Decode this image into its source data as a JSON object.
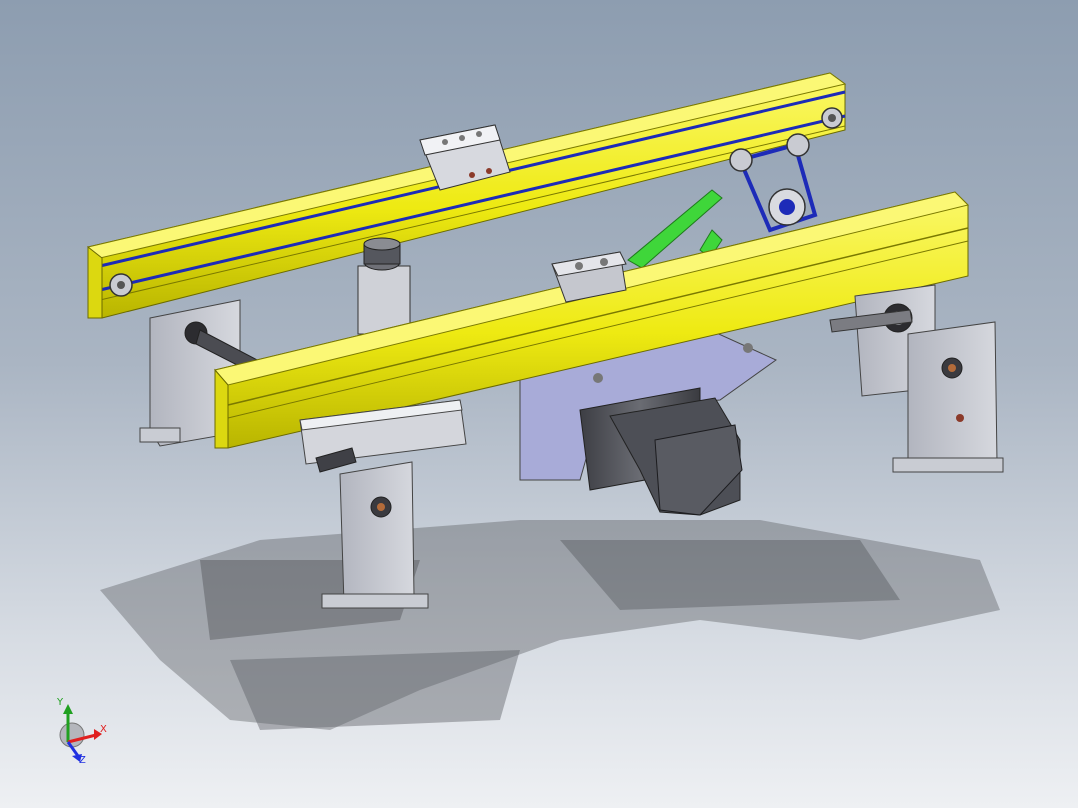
{
  "viewport": {
    "background_top": "#8d9db0",
    "background_bottom": "#eef0f3"
  },
  "model": {
    "rail_color": "#f2ee10",
    "belt_color": "#1d2bb8",
    "brace_color": "#3fd63a",
    "motor_color": "#5a5c62",
    "bracket_color": "#c3c6cf",
    "plate_color": "#a8abd8"
  },
  "triad": {
    "x_label": "X",
    "y_label": "Y",
    "z_label": "Z",
    "x_color": "#e02020",
    "y_color": "#20a020",
    "z_color": "#2030e0"
  }
}
